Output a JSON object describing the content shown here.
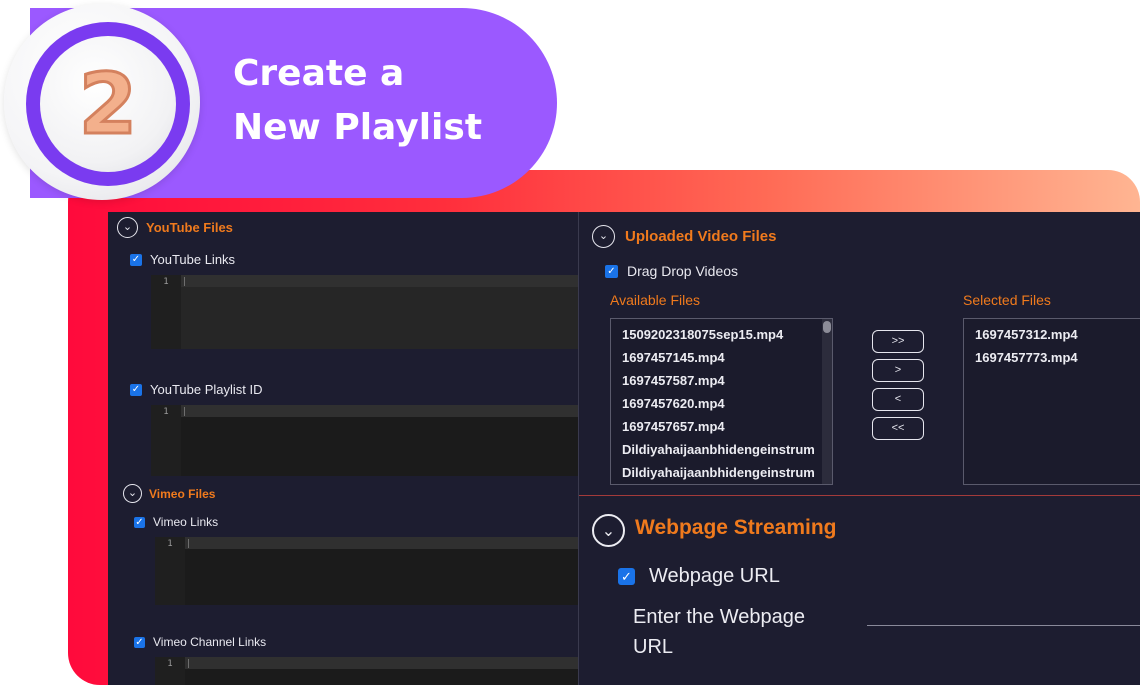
{
  "banner": {
    "step_number": "2",
    "title_line1": "Create a",
    "title_line2": "New Playlist"
  },
  "left": {
    "youtube": {
      "section_title": "YouTube Files",
      "links_label": "YouTube Links",
      "links_line": "1",
      "playlist_label": "YouTube Playlist ID",
      "playlist_line": "1"
    },
    "vimeo": {
      "section_title": "Vimeo Files",
      "links_label": "Vimeo Links",
      "links_line": "1",
      "channel_label": "Vimeo Channel Links",
      "channel_line": "1"
    }
  },
  "right": {
    "uploaded": {
      "section_title": "Uploaded Video Files",
      "drag_label": "Drag Drop Videos",
      "available_label": "Available Files",
      "selected_label": "Selected Files",
      "available_files": [
        "1509202318075sep15.mp4",
        "1697457145.mp4",
        "1697457587.mp4",
        "1697457620.mp4",
        "1697457657.mp4",
        "Dildiyahaijaanbhidengeinstrum",
        "Dildiyahaijaanbhidengeinstrum"
      ],
      "selected_files": [
        "1697457312.mp4",
        "1697457773.mp4"
      ],
      "buttons": {
        "move_all_right": ">>",
        "move_right": ">",
        "move_left": "<",
        "move_all_left": "<<"
      }
    },
    "webpage": {
      "section_title": "Webpage Streaming",
      "url_label": "Webpage URL",
      "enter_line1": "Enter the Webpage",
      "enter_line2": "URL"
    }
  },
  "colors": {
    "accent_orange": "#f07a1d",
    "purple": "#9b59ff",
    "panel_bg": "#1d1d30",
    "checkbox_blue": "#1a73e8"
  },
  "icons": {
    "chevron": "chevron-down-icon",
    "check": "check-icon"
  }
}
